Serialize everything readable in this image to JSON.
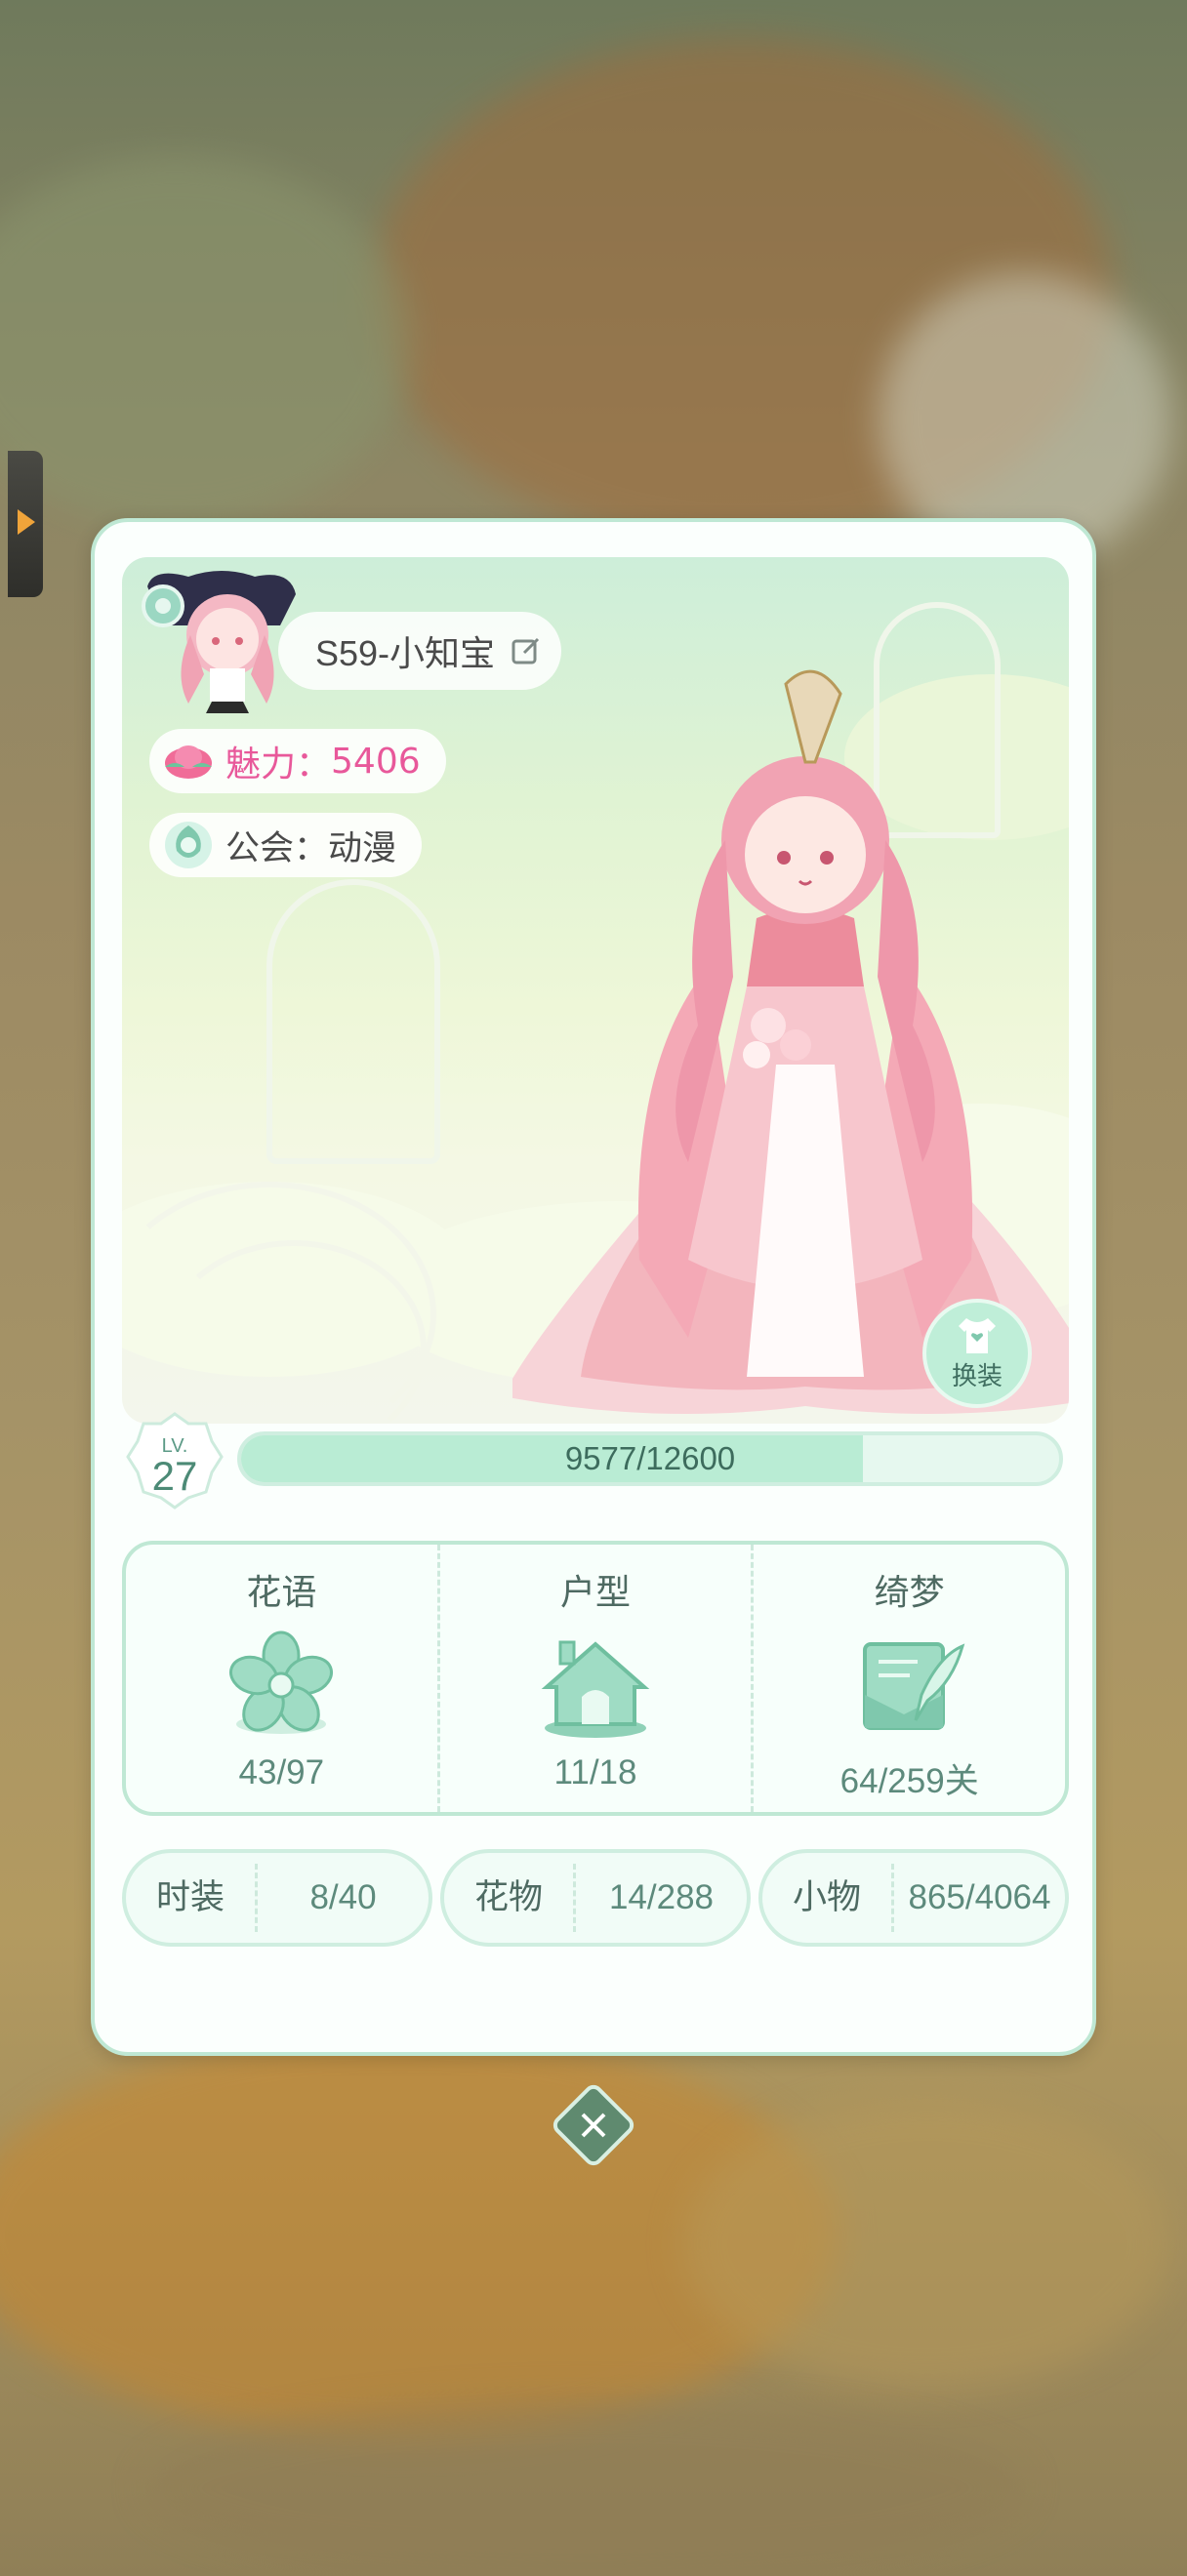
{
  "profile": {
    "name": "S59-小知宝",
    "charm_label": "魅力：",
    "charm_value": "5406",
    "guild_label": "公会：",
    "guild_value": "动漫",
    "dress_button": "换装"
  },
  "level": {
    "label": "LV.",
    "value": "27",
    "xp_text": "9577/12600",
    "xp_fraction": 0.76
  },
  "collections": [
    {
      "title": "花语",
      "value": "43/97",
      "icon": "flower-icon"
    },
    {
      "title": "户型",
      "value": "11/18",
      "icon": "house-icon"
    },
    {
      "title": "绮梦",
      "value": "64/259关",
      "icon": "letter-quill-icon"
    }
  ],
  "chips": [
    {
      "label": "时装",
      "value": "8/40"
    },
    {
      "label": "花物",
      "value": "14/288"
    },
    {
      "label": "小物",
      "value": "865/4064"
    }
  ],
  "colors": {
    "accent_green": "#bfe8d4",
    "charm_pink": "#e8589a",
    "text_green": "#5d8a7c"
  }
}
